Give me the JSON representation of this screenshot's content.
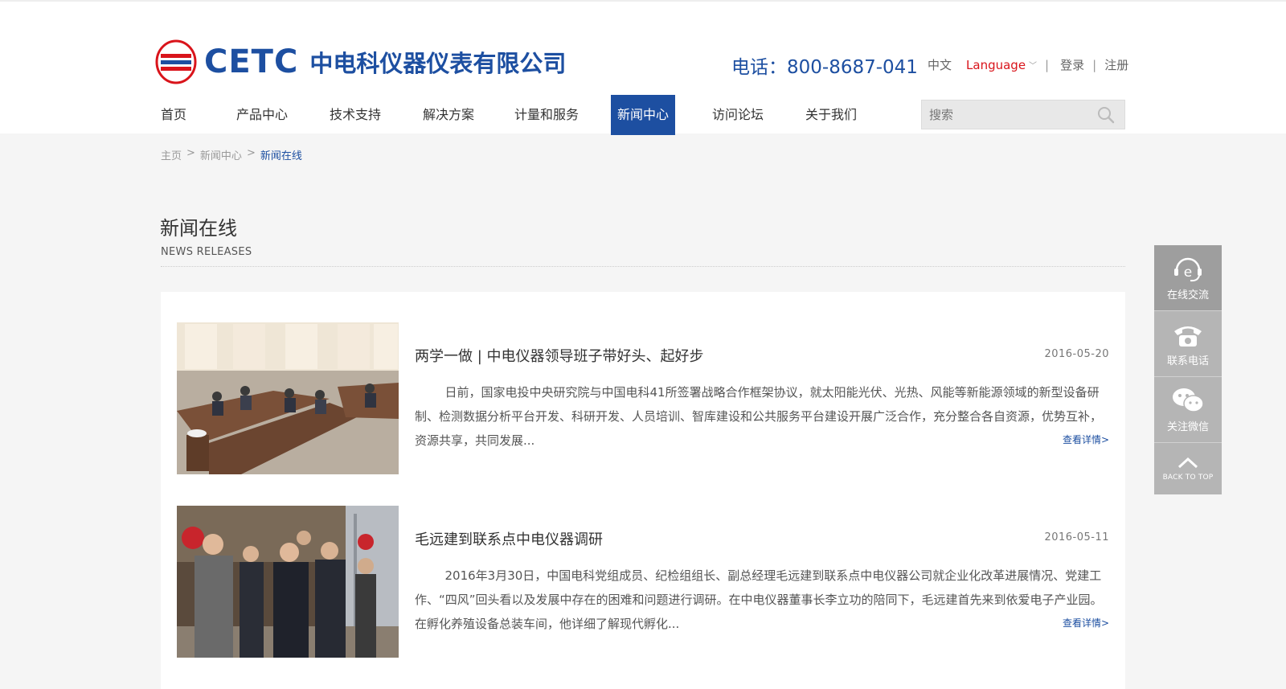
{
  "header": {
    "company_name": "中电科仪器仪表有限公司",
    "logo_text": "CETC",
    "phone": "电话：800-8687-041",
    "lang_cn": "中文",
    "language": "Language",
    "login": "登录",
    "register": "注册",
    "sep1": "|",
    "sep2": "|"
  },
  "nav": {
    "items": [
      {
        "label": "首页"
      },
      {
        "label": "产品中心"
      },
      {
        "label": "技术支持"
      },
      {
        "label": "解决方案"
      },
      {
        "label": "计量和服务"
      },
      {
        "label": "新闻中心",
        "active": true
      },
      {
        "label": "访问论坛"
      },
      {
        "label": "关于我们"
      }
    ]
  },
  "search": {
    "placeholder": "搜索"
  },
  "breadcrumb": {
    "home": "主页",
    "section": "新闻中心",
    "current": "新闻在线",
    "sep": ">"
  },
  "page": {
    "title": "新闻在线",
    "subtitle": "NEWS RELEASES"
  },
  "news": [
    {
      "title": "两学一做 | 中电仪器领导班子带好头、起好步",
      "date": "2016-05-20",
      "body": "日前，国家电投中央研究院与中国电科41所签署战略合作框架协议，就太阳能光伏、光热、风能等新能源领域的新型设备研制、检测数据分析平台开发、科研开发、人员培训、智库建设和公共服务平台建设开展广泛合作，充分整合各自资源，优势互补，资源共享，共同发展...",
      "more": "查看详情>"
    },
    {
      "title": "毛远建到联系点中电仪器调研",
      "date": "2016-05-11",
      "body": "2016年3月30日，中国电科党组成员、纪检组组长、副总经理毛远建到联系点中电仪器公司就企业化改革进展情况、党建工作、“四风”回头看以及发展中存在的困难和问题进行调研。在中电仪器董事长李立功的陪同下，毛远建首先来到依爱电子产业园。在孵化养殖设备总装车间，他详细了解现代孵化...",
      "more": "查看详情>"
    }
  ],
  "float_bar": {
    "chat": "在线交流",
    "phone": "联系电话",
    "wechat": "关注微信",
    "top": "BACK TO TOP"
  },
  "colors": {
    "brand": "#1d4fa1",
    "accent": "#d9141b"
  }
}
